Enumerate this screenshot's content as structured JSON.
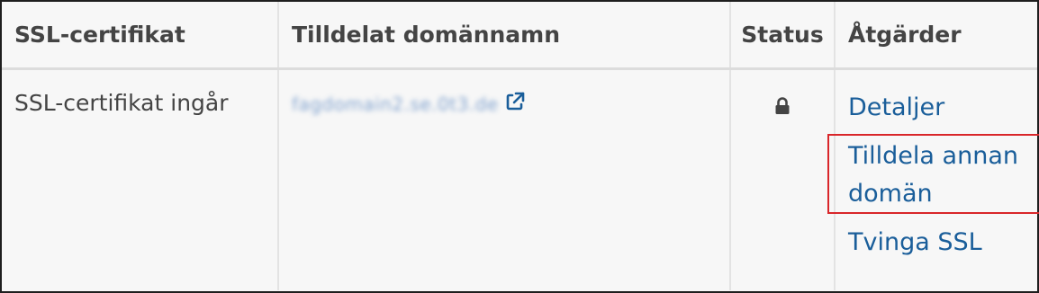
{
  "table": {
    "headers": [
      "SSL-certifikat",
      "Tilldelat domännamn",
      "Status",
      "Åtgärder"
    ],
    "row": {
      "certificate": "SSL-certifikat ingår",
      "domain": "fagdomain2.se.0t3.de",
      "status_icon": "lock-icon",
      "external_link_icon": "external-link-icon"
    },
    "actions": [
      "Detaljer",
      "Tilldela annan domän",
      "Tvinga SSL"
    ]
  },
  "colors": {
    "link": "#1a5e9a",
    "highlight": "#d9262a",
    "header_text": "#444444",
    "background": "#f7f7f7"
  }
}
